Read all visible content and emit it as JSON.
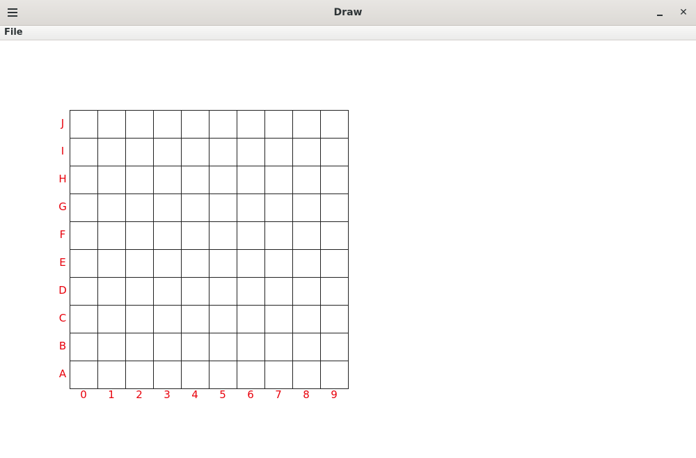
{
  "window": {
    "title": "Draw",
    "menu_icon": "hamburger-icon",
    "close_glyph": "✕"
  },
  "menubar": {
    "file_label": "File"
  },
  "board": {
    "row_labels": [
      "J",
      "I",
      "H",
      "G",
      "F",
      "E",
      "D",
      "C",
      "B",
      "A"
    ],
    "col_labels": [
      "0",
      "1",
      "2",
      "3",
      "4",
      "5",
      "6",
      "7",
      "8",
      "9"
    ],
    "label_color": "#e8000b",
    "line_color": "#222222"
  }
}
